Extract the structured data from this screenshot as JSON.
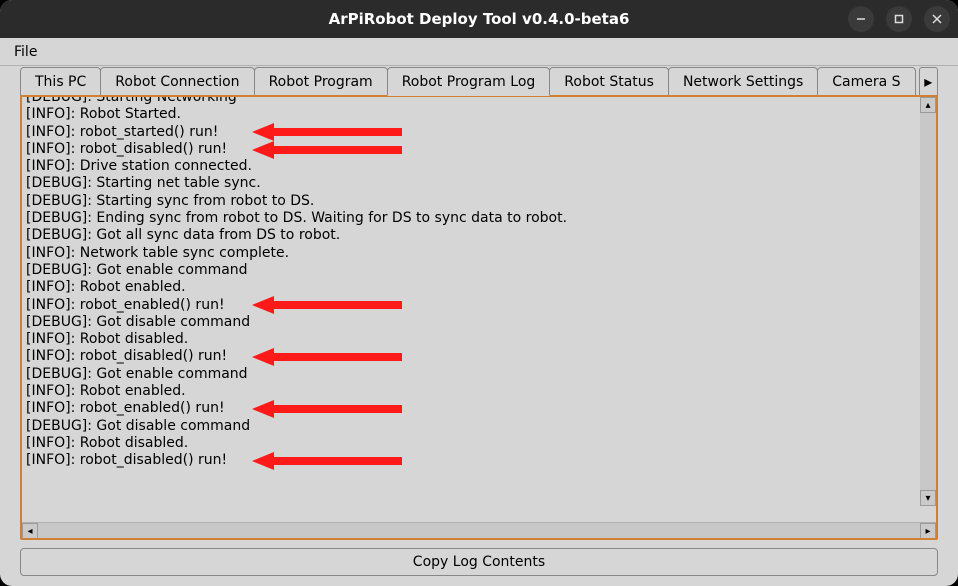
{
  "window": {
    "title": "ArPiRobot Deploy Tool v0.4.0-beta6"
  },
  "menubar": {
    "file": "File"
  },
  "tabs": [
    {
      "label": "This PC"
    },
    {
      "label": "Robot Connection"
    },
    {
      "label": "Robot Program"
    },
    {
      "label": "Robot Program Log"
    },
    {
      "label": "Robot Status"
    },
    {
      "label": "Network Settings"
    },
    {
      "label": "Camera S"
    }
  ],
  "active_tab_index": 3,
  "log_lines": [
    "[DEBUG]: Starting Networking",
    "[INFO]: Robot Started.",
    "[INFO]: robot_started() run!",
    "[INFO]: robot_disabled() run!",
    "[INFO]: Drive station connected.",
    "[DEBUG]: Starting net table sync.",
    "[DEBUG]: Starting sync from robot to DS.",
    "[DEBUG]: Ending sync from robot to DS. Waiting for DS to sync data to robot.",
    "[DEBUG]: Got all sync data from DS to robot.",
    "[INFO]: Network table sync complete.",
    "[DEBUG]: Got enable command",
    "[INFO]: Robot enabled.",
    "[INFO]: robot_enabled() run!",
    "[DEBUG]: Got disable command",
    "[INFO]: Robot disabled.",
    "[INFO]: robot_disabled() run!",
    "[DEBUG]: Got enable command",
    "[INFO]: Robot enabled.",
    "[INFO]: robot_enabled() run!",
    "[DEBUG]: Got disable command",
    "[INFO]: Robot disabled.",
    "[INFO]: robot_disabled() run!",
    ""
  ],
  "annotations": {
    "arrow_targets_line_indices": [
      2,
      3,
      12,
      15,
      18,
      21
    ],
    "arrow_color": "#ff1a1a"
  },
  "buttons": {
    "copy_log": "Copy Log Contents"
  }
}
